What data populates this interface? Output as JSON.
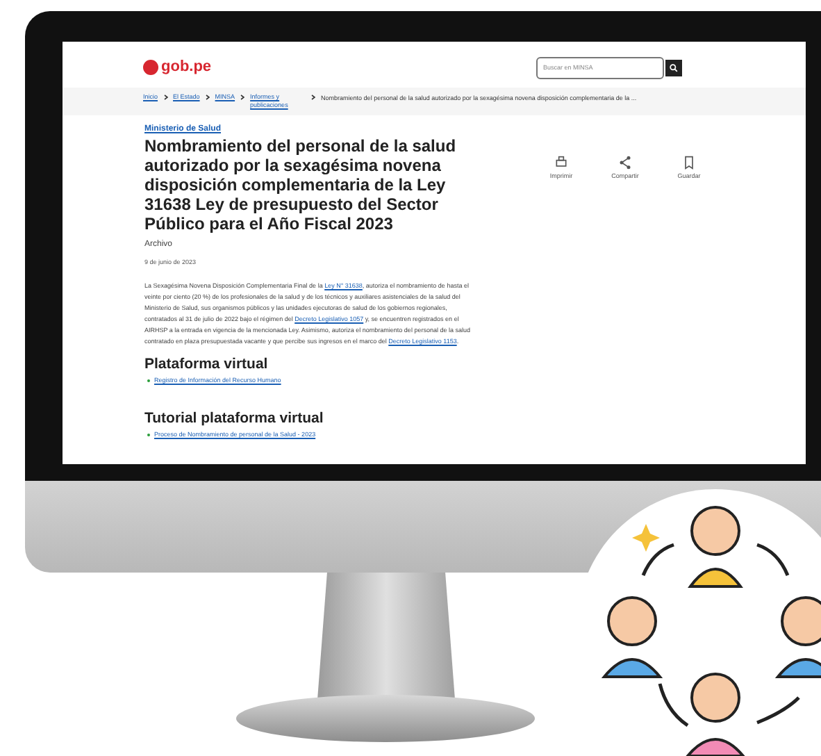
{
  "site": {
    "logo": "gob.pe",
    "search_placeholder": "Buscar en MINSA"
  },
  "breadcrumb": [
    {
      "text": "Inicio"
    },
    {
      "text": "El Estado"
    },
    {
      "text": "MINSA"
    },
    {
      "text": "Informes y publicaciones"
    },
    {
      "text": "Nombramiento del personal de la salud autorizado por la sexagésima novena disposición complementaria de la ..."
    }
  ],
  "article": {
    "institution": "Ministerio de Salud",
    "title": "Nombramiento del personal de la salud autorizado por la sexagésima novena disposición complementaria de la Ley 31638 Ley de presupuesto del Sector Público para el Año Fiscal 2023",
    "category": "Archivo",
    "date": "9 de junio de 2023",
    "actions": [
      {
        "kind": "print",
        "label": "Imprimir"
      },
      {
        "kind": "share",
        "label": "Compartir"
      },
      {
        "kind": "save",
        "label": "Guardar"
      }
    ],
    "paragraph": [
      {
        "kind": "text",
        "text": "La Sexagésima Novena Disposición Complementaria Final de la "
      },
      {
        "kind": "link",
        "text": "Ley N° 31638"
      },
      {
        "kind": "text",
        "text": ", autoriza el nombramiento de hasta el veinte por ciento (20 %) de los profesionales de la salud y de los técnicos y auxiliares asistenciales de la salud del Ministerio de Salud, sus organismos públicos y las unidades ejecutoras de salud de los gobiernos regionales, contratados al 31 de julio de 2022 bajo el régimen del "
      },
      {
        "kind": "link",
        "text": "Decreto Legislativo 1057"
      },
      {
        "kind": "text",
        "text": " y, se encuentren registrados en el AIRHSP a la entrada en vigencia de la mencionada Ley. Asimismo, autoriza el nombramiento del personal de la salud contratado en plaza presupuestada vacante y que percibe sus ingresos en el marco del "
      },
      {
        "kind": "link",
        "text": "Decreto Legislativo 1153"
      },
      {
        "kind": "text",
        "text": "."
      }
    ],
    "sections": [
      {
        "heading": "Plataforma virtual",
        "links": [
          "Registro de Información del Recurso Humano"
        ]
      },
      {
        "heading": "Tutorial plataforma virtual",
        "links": [
          "Proceso de Nombramiento de personal de la Salud - 2023"
        ]
      }
    ]
  }
}
